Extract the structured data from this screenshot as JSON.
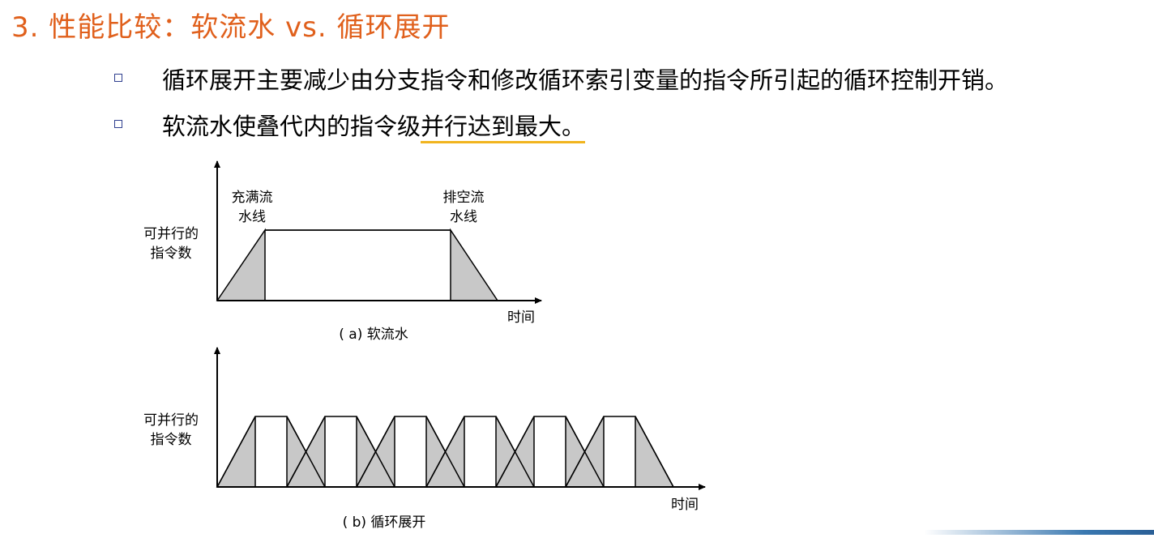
{
  "slide": {
    "title": "3. 性能比较：软流水 vs. 循环展开",
    "bullets": [
      {
        "text": "循环展开主要减少由分支指令和修改循环索引变量的指令所引起的循环控制开销。"
      },
      {
        "text_before": "软流水使叠代内的指令级",
        "text_highlight": "并行达到最大。"
      }
    ]
  },
  "diagram_a": {
    "ylabel_line1": "可并行的",
    "ylabel_line2": "指令数",
    "fill_label_line1": "充满流",
    "fill_label_line2": "水线",
    "drain_label_line1": "排空流",
    "drain_label_line2": "水线",
    "xlabel": "时间",
    "caption": "( a) 软流水"
  },
  "diagram_b": {
    "ylabel_line1": "可并行的",
    "ylabel_line2": "指令数",
    "xlabel": "时间",
    "caption": "( b) 循环展开"
  },
  "colors": {
    "title": "#e0601c",
    "bullet": "#2f3f8f",
    "highlight_underline": "#f1b41e",
    "shade": "#c8c8c8"
  }
}
